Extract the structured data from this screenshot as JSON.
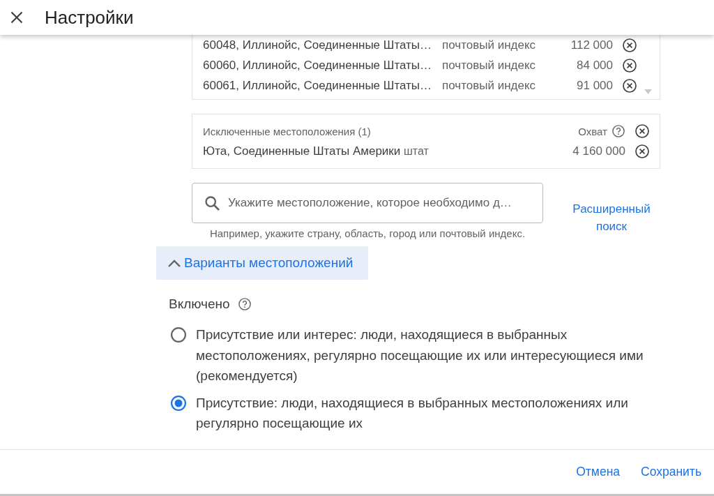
{
  "header": {
    "title": "Настройки"
  },
  "included_locations": {
    "rows": [
      {
        "name": "60048, Иллинойс, Соединенные Штаты…",
        "type": "почтовый индекс",
        "reach": "112 000"
      },
      {
        "name": "60060, Иллинойс, Соединенные Штаты…",
        "type": "почтовый индекс",
        "reach": "84 000"
      },
      {
        "name": "60061, Иллинойс, Соединенные Штаты…",
        "type": "почтовый индекс",
        "reach": "91 000"
      }
    ]
  },
  "excluded_locations": {
    "title": "Исключенные местоположения (1)",
    "reach_label": "Охват",
    "rows": [
      {
        "name": "Юта, Соединенные Штаты Америки",
        "type": "штат",
        "reach": "4 160 000"
      }
    ]
  },
  "search": {
    "placeholder": "Укажите местоположение, которое необходимо д…",
    "hint": "Например, укажите страну, область, город или почтовый индекс."
  },
  "advanced_search_link": "Расширенный поиск",
  "location_options": {
    "label": "Варианты местоположений",
    "expanded": true
  },
  "targeting": {
    "label": "Включено",
    "options": [
      {
        "label": "Присутствие или интерес: люди, находящиеся в выбранных местоположениях, регулярно посещающие их или интересующиеся ими (рекомендуется)",
        "selected": false
      },
      {
        "label": "Присутствие: люди, находящиеся в выбранных местоположениях или регулярно посещающие их",
        "selected": true
      }
    ]
  },
  "buttons": [
    {
      "label": "Отмена"
    },
    {
      "label": "Сохранить"
    }
  ]
}
